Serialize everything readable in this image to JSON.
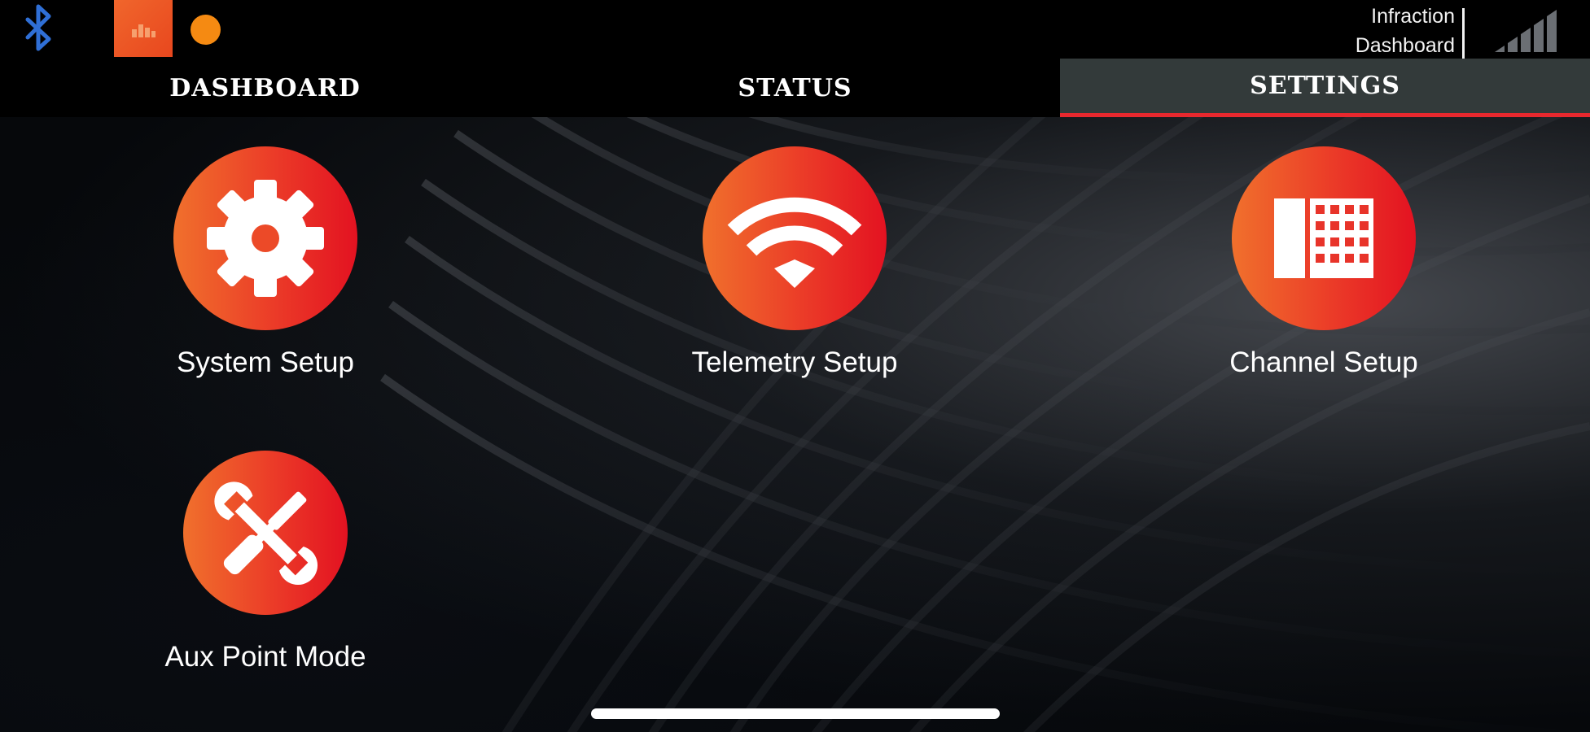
{
  "status_bar": {
    "bluetooth_icon": "bluetooth-icon",
    "app_badge_icon": "bar-chart-icon",
    "indicator_color": "#f58a12",
    "infraction_line1": "Infraction",
    "infraction_line2": "Dashboard",
    "signal_icon": "signal-strength-icon"
  },
  "tabs": [
    {
      "label": "DASHBOARD",
      "active": false
    },
    {
      "label": "STATUS",
      "active": false
    },
    {
      "label": "SETTINGS",
      "active": true
    }
  ],
  "tiles": {
    "system_setup": {
      "label": "System Setup",
      "icon": "gear-icon"
    },
    "telemetry_setup": {
      "label": "Telemetry Setup",
      "icon": "wifi-icon"
    },
    "channel_setup": {
      "label": "Channel Setup",
      "icon": "keypad-grid-icon"
    },
    "aux_point_mode": {
      "label": "Aux Point Mode",
      "icon": "tools-icon"
    }
  },
  "colors": {
    "accent_gradient_start": "#f0702c",
    "accent_gradient_end": "#e31221",
    "active_tab_bg": "#333a3a",
    "active_tab_underline": "#e8282e"
  }
}
